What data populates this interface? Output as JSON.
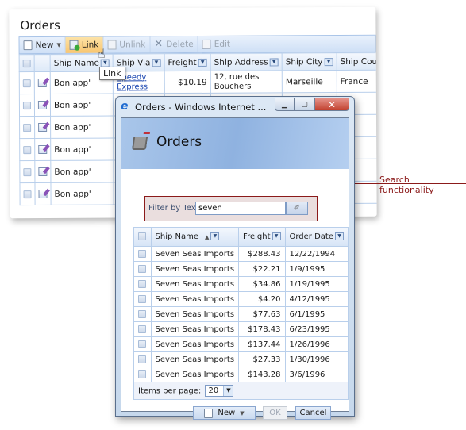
{
  "background": {
    "title": "Orders",
    "toolbar": [
      {
        "icon": "new-page-icon",
        "label": "New",
        "has_dropdown": true,
        "state": "normal"
      },
      {
        "icon": "link-icon",
        "label": "Link",
        "state": "hover"
      },
      {
        "icon": "unlink-icon",
        "label": "Unlink",
        "state": "disabled"
      },
      {
        "icon": "delete-icon",
        "label": "Delete",
        "state": "disabled"
      },
      {
        "icon": "edit-icon",
        "label": "Edit",
        "state": "disabled"
      }
    ],
    "tooltip": "Link",
    "columns": [
      "Ship Name",
      "Ship Via",
      "Freight",
      "Ship Address",
      "Ship City",
      "Ship Country"
    ],
    "rows": [
      {
        "ship_name": "Bon app'",
        "ship_via": "Speedy Express",
        "freight": "$10.19",
        "ship_address": "12, rue des Bouchers",
        "ship_city": "Marseille",
        "ship_country": "France"
      },
      {
        "ship_name": "Bon app'"
      },
      {
        "ship_name": "Bon app'"
      },
      {
        "ship_name": "Bon app'"
      },
      {
        "ship_name": "Bon app'"
      },
      {
        "ship_name": "Bon app'"
      }
    ]
  },
  "popup": {
    "window_title": "Orders - Windows Internet ...",
    "header_title": "Orders",
    "filter": {
      "label": "Filter by Text",
      "value": "seven"
    },
    "columns": [
      "Ship Name",
      "Freight",
      "Order Date"
    ],
    "sort": {
      "column": "Ship Name",
      "direction": "ascending"
    },
    "rows": [
      {
        "ship_name": "Seven Seas Imports",
        "freight": "$288.43",
        "order_date": "12/22/1994"
      },
      {
        "ship_name": "Seven Seas Imports",
        "freight": "$22.21",
        "order_date": "1/9/1995"
      },
      {
        "ship_name": "Seven Seas Imports",
        "freight": "$34.86",
        "order_date": "1/19/1995"
      },
      {
        "ship_name": "Seven Seas Imports",
        "freight": "$4.20",
        "order_date": "4/12/1995"
      },
      {
        "ship_name": "Seven Seas Imports",
        "freight": "$77.63",
        "order_date": "6/1/1995"
      },
      {
        "ship_name": "Seven Seas Imports",
        "freight": "$178.43",
        "order_date": "6/23/1995"
      },
      {
        "ship_name": "Seven Seas Imports",
        "freight": "$137.44",
        "order_date": "1/26/1996"
      },
      {
        "ship_name": "Seven Seas Imports",
        "freight": "$27.33",
        "order_date": "1/30/1996"
      },
      {
        "ship_name": "Seven Seas Imports",
        "freight": "$143.28",
        "order_date": "3/6/1996"
      }
    ],
    "pager": {
      "label": "Items per page:",
      "value": "20"
    },
    "buttons": {
      "new": "New",
      "ok": "OK",
      "cancel": "Cancel"
    }
  },
  "callout": {
    "text": "Search functionality",
    "color": "#8b1a1a"
  }
}
